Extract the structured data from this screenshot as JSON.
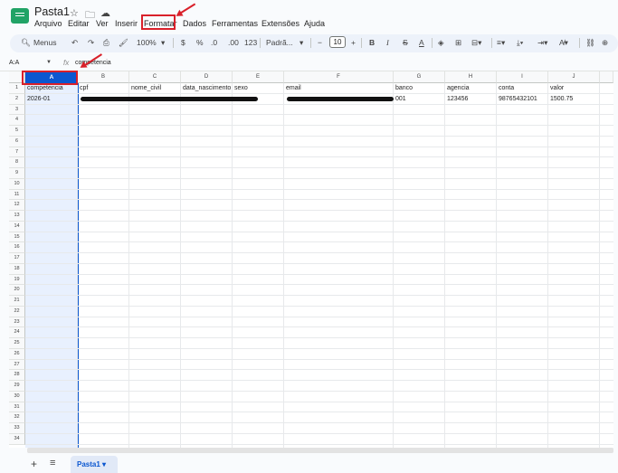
{
  "doc_title": "Pasta1",
  "title_icons": [
    "star-icon",
    "folder-icon",
    "cloud-icon"
  ],
  "menus": [
    "Arquivo",
    "Editar",
    "Ver",
    "Inserir",
    "Formatar",
    "Dados",
    "Ferramentas",
    "Extensões",
    "Ajuda"
  ],
  "highlighted_menu": "Formatar",
  "toolbar": {
    "search_menus": "Menus",
    "zoom": "100%",
    "currency": "$",
    "percent": "%",
    "decrease_decimal": ".0",
    "increase_decimal": ".00",
    "number_format": "123",
    "font_name": "Padrã...",
    "font_size": "10",
    "bold": "B",
    "italic": "I",
    "strikethrough": "S",
    "text_color": "A"
  },
  "formula_bar": {
    "name_box": "A:A",
    "fx": "fx",
    "formula": "competencia"
  },
  "columns": [
    "A",
    "B",
    "C",
    "D",
    "E",
    "F",
    "G",
    "H",
    "I",
    "J"
  ],
  "row_numbers": [
    "1",
    "2",
    "3",
    "4",
    "5",
    "6",
    "7",
    "8",
    "9",
    "10",
    "11",
    "12",
    "13",
    "14",
    "15",
    "16",
    "17",
    "18",
    "19",
    "20",
    "21",
    "22",
    "23",
    "24",
    "25",
    "26",
    "27",
    "28",
    "29",
    "30",
    "31",
    "32",
    "33",
    "34"
  ],
  "rows": [
    [
      "competencia",
      "cpf",
      "nome_civil",
      "data_nascimento",
      "sexo",
      "email",
      "banco",
      "agencia",
      "conta",
      "valor"
    ],
    [
      "2026-01",
      "",
      "",
      "",
      "",
      "",
      "001",
      "123456",
      "98765432101",
      "1500.75"
    ]
  ],
  "sheet_tab": "Pasta1",
  "colors": {
    "accent": "#0b57d0",
    "highlight_red": "#d9202a",
    "sheets_green": "#21a366"
  }
}
